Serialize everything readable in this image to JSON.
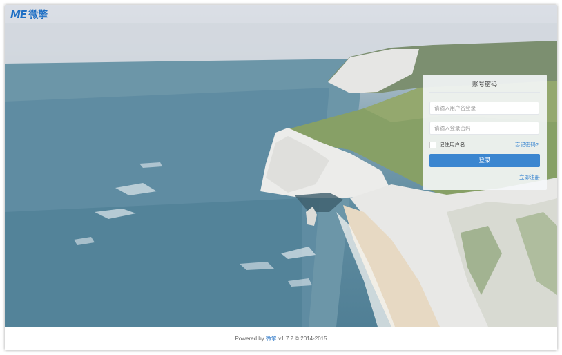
{
  "header": {
    "logo_mark": "ME",
    "logo_text": "微擎"
  },
  "login": {
    "tab_label": "账号密码",
    "username_placeholder": "请输入用户名登录",
    "password_placeholder": "请输入登录密码",
    "remember_label": "记住用户名",
    "forgot_label": "忘记密码?",
    "submit_label": "登录",
    "register_label": "立即注册"
  },
  "footer": {
    "prefix": "Powered by",
    "brand": "微擎",
    "suffix": "v1.7.2 © 2014-2015"
  },
  "colors": {
    "accent": "#3b86d0",
    "brand": "#1f6fc4"
  }
}
